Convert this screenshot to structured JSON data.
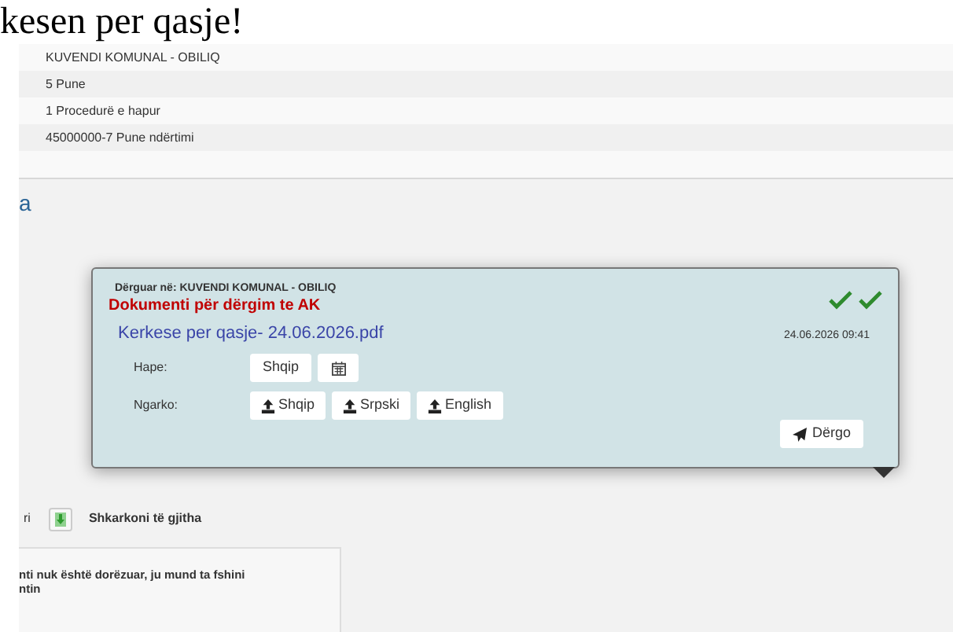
{
  "heading": "kesen per qasje!",
  "details": [
    "KUVENDI KOMUNAL - OBILIQ",
    "5 Pune",
    "1 Procedurë e hapur",
    "45000000-7 Pune ndërtimi"
  ],
  "section_title": "a",
  "document_card": {
    "sent_to": "Dërguar në: KUVENDI KOMUNAL - OBILIQ",
    "title": "Dokumenti për dërgim te AK",
    "file": "Kerkese per qasje- 24.06.2026.pdf",
    "date": "24.06.2026 09:41",
    "delivered": true,
    "open_label": "Hape:",
    "open_buttons": [
      {
        "kind": "text",
        "label": "Shqip"
      },
      {
        "kind": "calendar"
      }
    ],
    "upload_label": "Ngarko:",
    "upload_buttons": [
      "Shqip",
      "Srpski",
      "English"
    ],
    "send_button": "Dërgo"
  },
  "toolbar": {
    "left_text": "ri",
    "download_all": "Shkarkoni të gjitha"
  },
  "notice": {
    "lines": [
      "nti nuk është dorëzuar, ju mund ta fshini",
      "ntin"
    ]
  }
}
